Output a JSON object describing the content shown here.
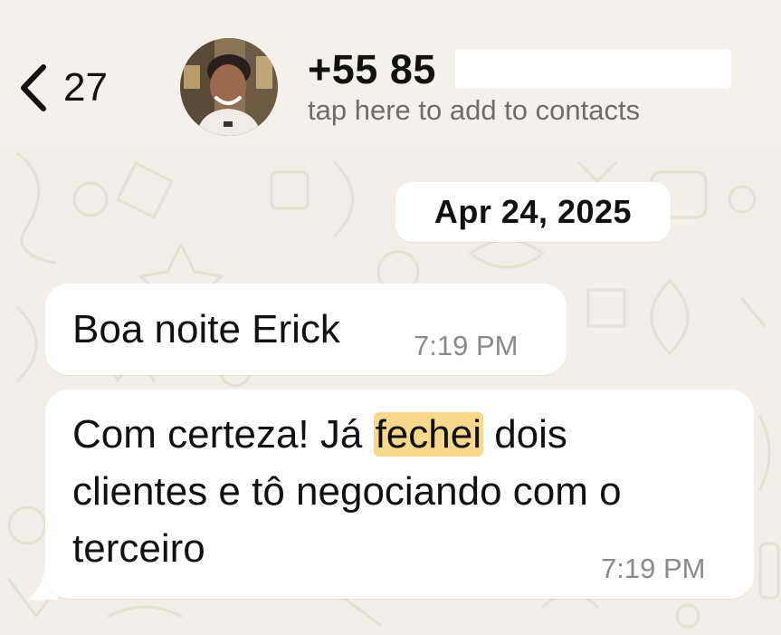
{
  "header": {
    "back_count": "27",
    "contact_phone_visible": "+55 85",
    "contact_phone_redacted": true,
    "subtitle": "tap here to add to contacts"
  },
  "chat": {
    "date_chip": "Apr 24, 2025",
    "messages": [
      {
        "text": "Boa noite Erick",
        "time": "7:19 PM"
      },
      {
        "text_before": "Com certeza! Já ",
        "highlight": "fechei",
        "text_after_line1": " dois",
        "text_line2": "clientes e tô negociando com o",
        "text_line3": "terceiro",
        "time": "7:19 PM"
      }
    ]
  },
  "colors": {
    "background": "#f3efe8",
    "bubble": "#ffffff",
    "highlight": "#f7d88d",
    "subtitle": "#6d6d6d",
    "time": "#8a8a8a"
  },
  "icons": {
    "back": "chevron-left-icon"
  }
}
